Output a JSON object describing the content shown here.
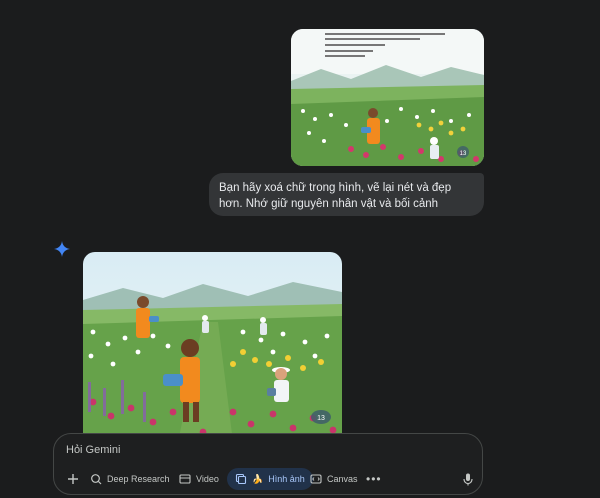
{
  "user_message": {
    "image_alt_icon": "uploaded-illustration",
    "image_page_number": "13",
    "text": "Bạn hãy xoá chữ trong hình, vẽ lại nét và đẹp hơn. Nhớ giữ nguyên nhân vật và bối cảnh"
  },
  "response": {
    "image_page_number": "13"
  },
  "input": {
    "placeholder": "Hỏi Gemini"
  },
  "toolbar": {
    "deep_research": "Deep Research",
    "video": "Video",
    "image": "Hình ảnh",
    "canvas": "Canvas",
    "more": "•••"
  },
  "colors": {
    "background": "#1b1c1d",
    "bubble": "#333537",
    "active_chip": "#21324a",
    "active_text": "#a8c7fa",
    "gemini_blue": "#4285f4"
  }
}
